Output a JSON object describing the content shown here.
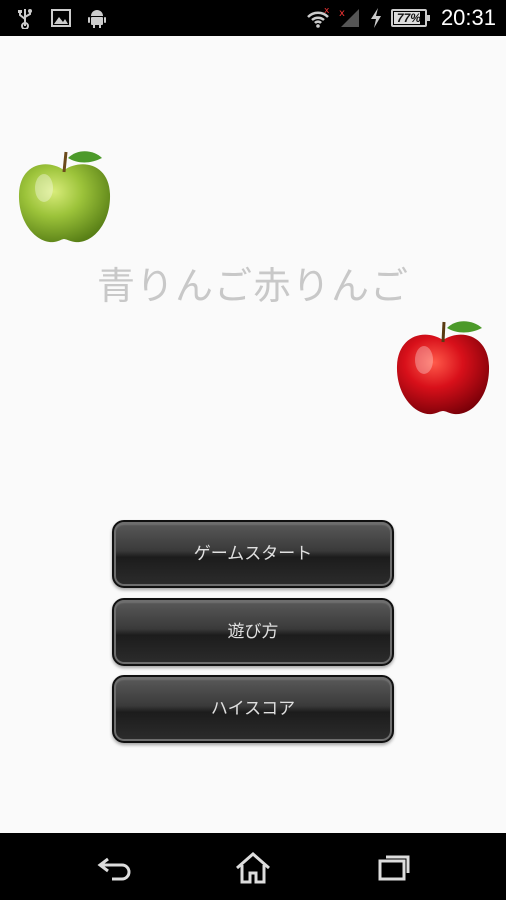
{
  "status_bar": {
    "time": "20:31",
    "battery_level": "77%",
    "icons": [
      "usb-icon",
      "image-icon",
      "android-icon",
      "wifi-icon",
      "signal-icon",
      "charging-icon",
      "battery-icon"
    ]
  },
  "main": {
    "title": "青りんご赤りんご",
    "buttons": {
      "start": "ゲームスタート",
      "how_to_play": "遊び方",
      "high_score": "ハイスコア"
    }
  },
  "nav_bar": {
    "icons": [
      "back-icon",
      "home-icon",
      "recent-apps-icon"
    ]
  }
}
